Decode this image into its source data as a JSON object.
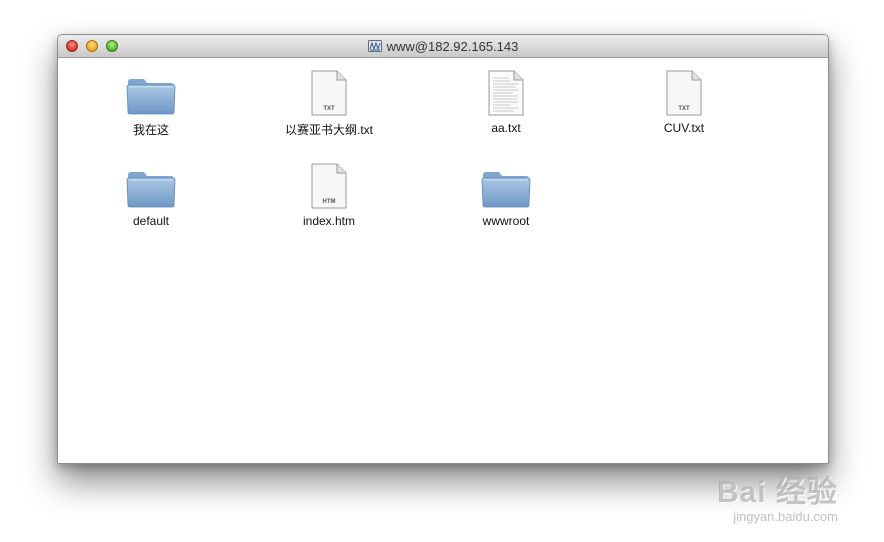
{
  "window": {
    "title": "www@182.92.165.143",
    "title_icon": "network-drive-icon"
  },
  "items": [
    {
      "name": "我在这",
      "kind": "folder"
    },
    {
      "name": "以赛亚书大纲.txt",
      "kind": "file",
      "badge": "TXT"
    },
    {
      "name": "aa.txt",
      "kind": "document"
    },
    {
      "name": "CUV.txt",
      "kind": "file",
      "badge": "TXT"
    },
    {
      "name": "default",
      "kind": "folder"
    },
    {
      "name": "index.htm",
      "kind": "file",
      "badge": "HTM"
    },
    {
      "name": "wwwroot",
      "kind": "folder"
    }
  ],
  "watermark": {
    "main": "Bai 经验",
    "sub": "jingyan.baidu.com"
  },
  "colors": {
    "folder": "#8fb3d6",
    "close": "#e0443a",
    "minimize": "#f0b22a",
    "zoom": "#62c13a"
  }
}
